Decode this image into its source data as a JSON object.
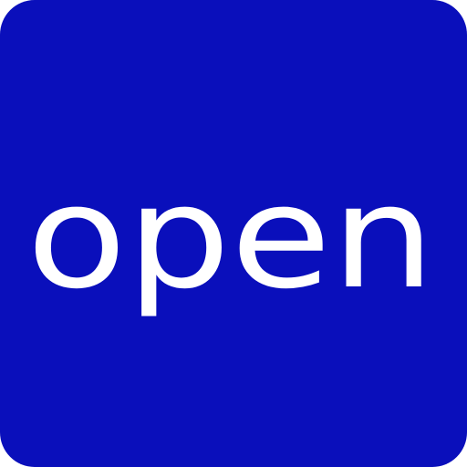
{
  "logo": {
    "text": "open",
    "background_color": "#0a0fbb",
    "text_color": "#ffffff"
  }
}
